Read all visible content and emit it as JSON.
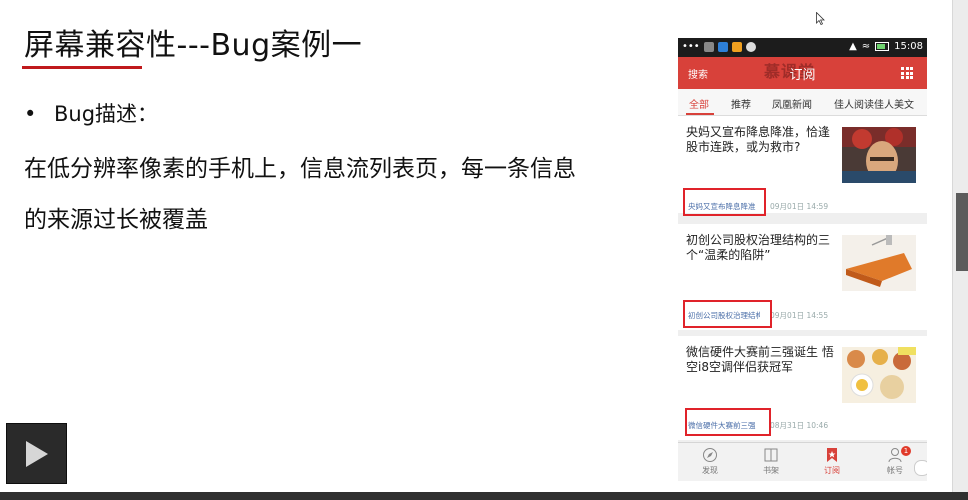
{
  "slide": {
    "title": "屏幕兼容性---Bug案例一",
    "bullet_marker": "•",
    "bullet_label": "Bug描述：",
    "description_line1": "在低分辨率像素的手机上，信息流列表页，每一条信息",
    "description_line2": "的来源过长被覆盖"
  },
  "phone": {
    "status_time": "15:08",
    "status_dots": "•••",
    "search_label": "搜索",
    "title": "订阅",
    "watermark": "慕课堂",
    "tabs": [
      "全部",
      "推荐",
      "凤凰新闻",
      "佳人阅读佳人美文"
    ],
    "articles": [
      {
        "headline": "央妈又宣布降息降准，恰逢股市连跌，或为救市?",
        "source": "央妈又宣布降息降准",
        "time": "09月01日 14:59"
      },
      {
        "headline": "初创公司股权治理结构的三个“温柔的陷阱”",
        "source": "初创公司股权治理结构",
        "time": "09月01日 14:55"
      },
      {
        "headline": "微信硬件大赛前三强诞生 悟空i8空调伴侣获冠军",
        "source": "微信硬件大赛前三强",
        "time": "08月31日 10:46"
      }
    ],
    "nav": [
      "发现",
      "书架",
      "订阅",
      "帐号"
    ],
    "badge_count": "1"
  },
  "colors": {
    "accent": "#d8413a",
    "highlight_box": "#e0232a",
    "title_rule": "#c0191c"
  }
}
